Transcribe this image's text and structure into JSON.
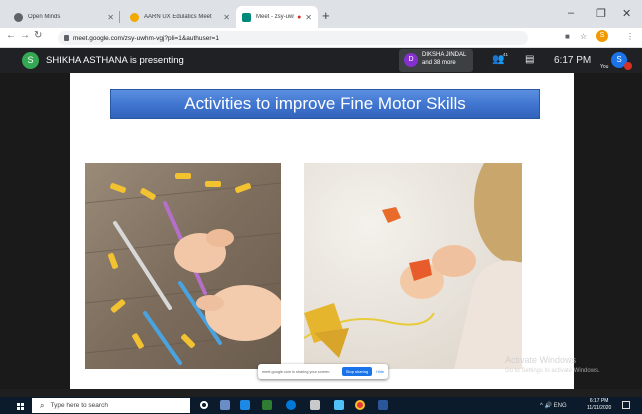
{
  "browser": {
    "tabs": [
      {
        "title": "Open Minds",
        "favicon_color": "#5f6368",
        "active": false
      },
      {
        "title": "AARN UX Edulatics Meet",
        "favicon_color": "#f2a900",
        "active": false
      },
      {
        "title": "Meet - zsy-uwhm-vgj",
        "favicon_color": "#00897b",
        "active": true
      }
    ],
    "new_tab_icon": "+",
    "url": "meet.google.com/zsy-uwhm-vgj?pli=1&authuser=1",
    "profile_initial": "S"
  },
  "meet": {
    "presenter_initial": "S",
    "presenter_text": "SHIKHA ASTHANA is presenting",
    "participant_initial": "D",
    "participant_name": "DIKSHA JINDAL",
    "participant_more": "and 38 more",
    "people_count": "41",
    "time": "6:17 PM",
    "you_label": "You",
    "you_initial": "S"
  },
  "slide": {
    "title": "Activities to improve Fine Motor Skills"
  },
  "share_bar": {
    "text": "meet.google.com is sharing your screen.",
    "stop_label": "Stop sharing",
    "hide_label": "Hide"
  },
  "watermark": {
    "line1": "Activate Windows",
    "line2": "Go to Settings to activate Windows."
  },
  "taskbar": {
    "search_placeholder": "Type here to search",
    "time": "6:17 PM",
    "date": "11/11/2020",
    "tray": "^ 🔊 ENG"
  },
  "colors": {
    "meet_bar": "#202124",
    "slide_title_blue": "#3f74cf",
    "taskbar": "#0b1b2c",
    "accent": "#1a73e8"
  }
}
